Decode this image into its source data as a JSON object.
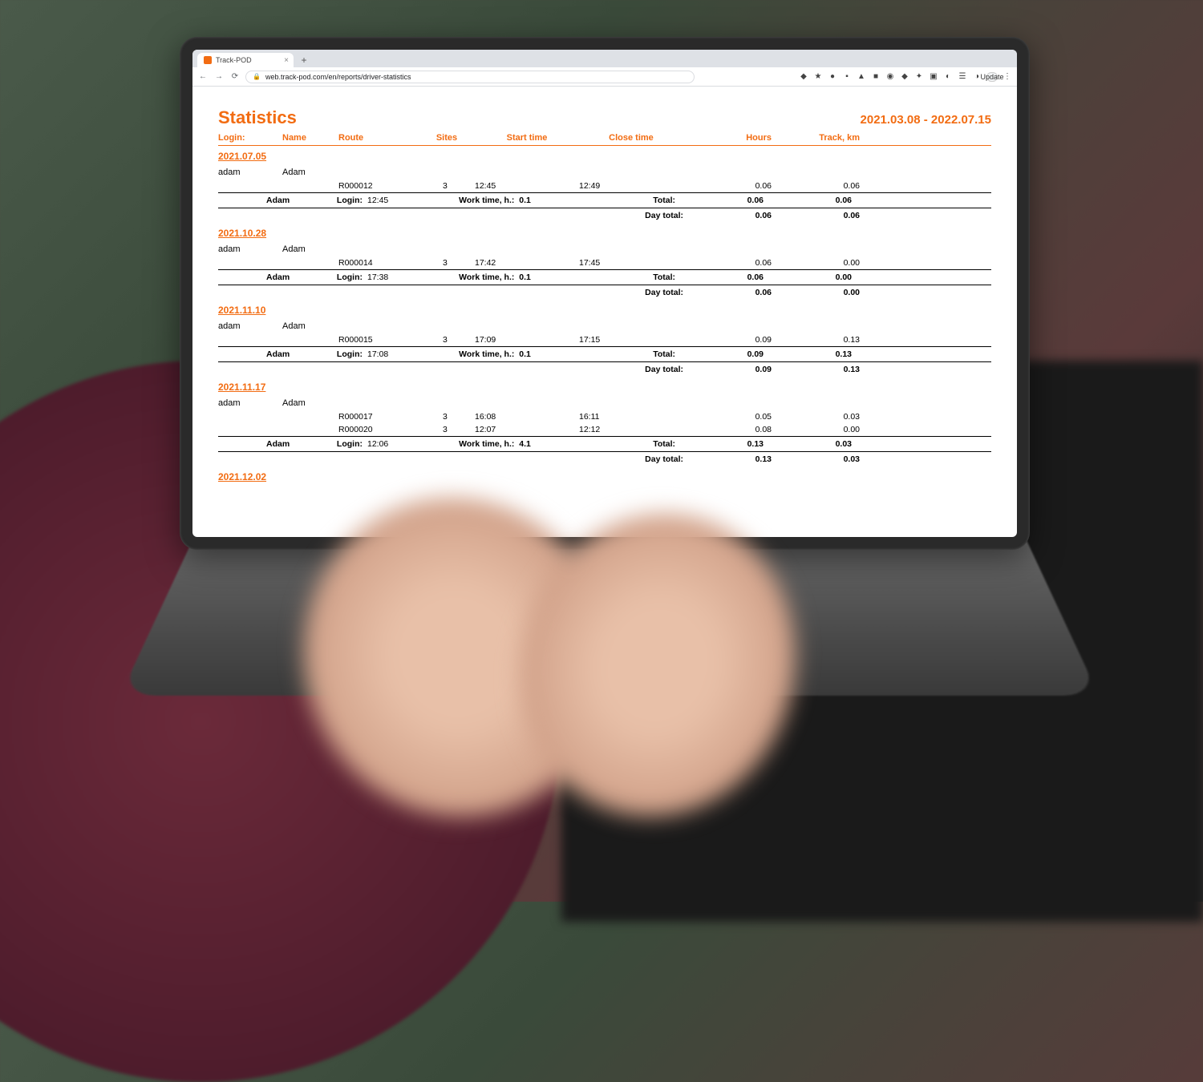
{
  "browser": {
    "tab_title": "Track-POD",
    "url": "web.track-pod.com/en/reports/driver-statistics",
    "update_label": "Update"
  },
  "report": {
    "title": "Statistics",
    "date_range": "2021.03.08 - 2022.07.15",
    "headers": {
      "login": "Login:",
      "name": "Name",
      "route": "Route",
      "sites": "Sites",
      "start_time": "Start time",
      "close_time": "Close time",
      "hours": "Hours",
      "track": "Track, km"
    },
    "labels": {
      "login": "Login:",
      "work_time": "Work time, h.:",
      "total": "Total:",
      "day_total": "Day total:"
    },
    "days": [
      {
        "date": "2021.07.05",
        "login": "adam",
        "name": "Adam",
        "routes": [
          {
            "route": "R000012",
            "sites": "3",
            "start": "12:45",
            "close": "12:49",
            "hours": "0.06",
            "track": "0.06"
          }
        ],
        "summary": {
          "name": "Adam",
          "login_time": "12:45",
          "work_time": "0.1",
          "total_hours": "0.06",
          "total_track": "0.06"
        },
        "day_total": {
          "hours": "0.06",
          "track": "0.06"
        }
      },
      {
        "date": "2021.10.28",
        "login": "adam",
        "name": "Adam",
        "routes": [
          {
            "route": "R000014",
            "sites": "3",
            "start": "17:42",
            "close": "17:45",
            "hours": "0.06",
            "track": "0.00"
          }
        ],
        "summary": {
          "name": "Adam",
          "login_time": "17:38",
          "work_time": "0.1",
          "total_hours": "0.06",
          "total_track": "0.00"
        },
        "day_total": {
          "hours": "0.06",
          "track": "0.00"
        }
      },
      {
        "date": "2021.11.10",
        "login": "adam",
        "name": "Adam",
        "routes": [
          {
            "route": "R000015",
            "sites": "3",
            "start": "17:09",
            "close": "17:15",
            "hours": "0.09",
            "track": "0.13"
          }
        ],
        "summary": {
          "name": "Adam",
          "login_time": "17:08",
          "work_time": "0.1",
          "total_hours": "0.09",
          "total_track": "0.13"
        },
        "day_total": {
          "hours": "0.09",
          "track": "0.13"
        }
      },
      {
        "date": "2021.11.17",
        "login": "adam",
        "name": "Adam",
        "routes": [
          {
            "route": "R000017",
            "sites": "3",
            "start": "16:08",
            "close": "16:11",
            "hours": "0.05",
            "track": "0.03"
          },
          {
            "route": "R000020",
            "sites": "3",
            "start": "12:07",
            "close": "12:12",
            "hours": "0.08",
            "track": "0.00"
          }
        ],
        "summary": {
          "name": "Adam",
          "login_time": "12:06",
          "work_time": "4.1",
          "total_hours": "0.13",
          "total_track": "0.03"
        },
        "day_total": {
          "hours": "0.13",
          "track": "0.03"
        }
      },
      {
        "date": "2021.12.02"
      }
    ]
  }
}
